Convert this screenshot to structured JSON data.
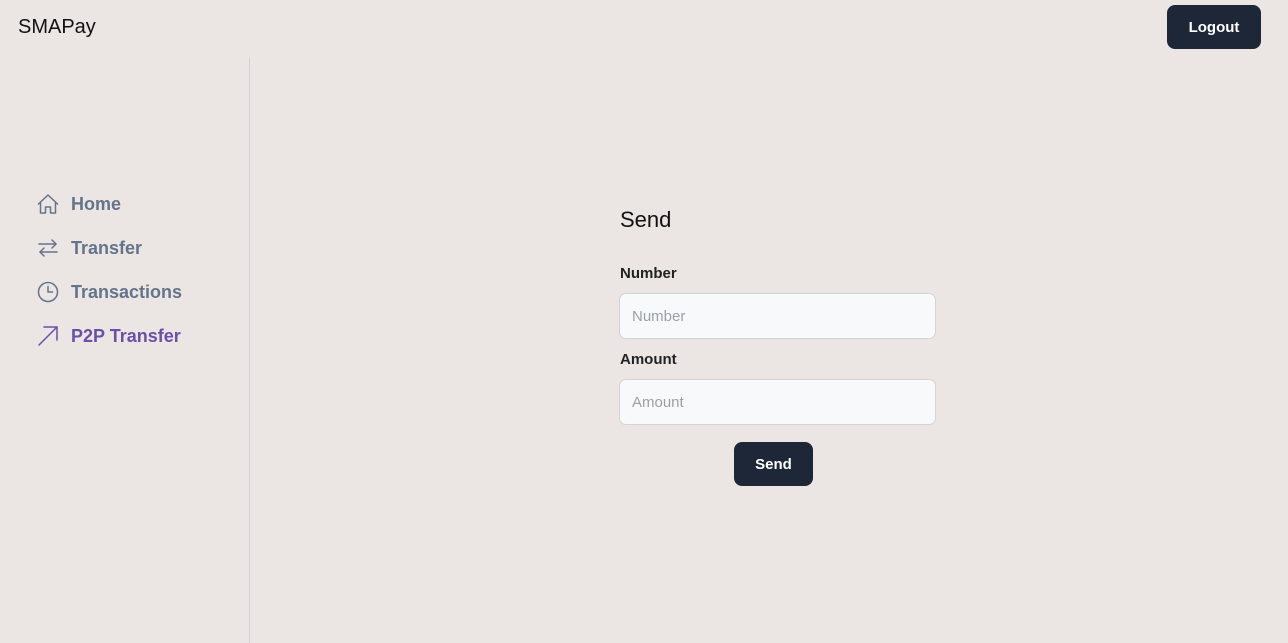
{
  "header": {
    "brand": "SMAPay",
    "logout_label": "Logout"
  },
  "sidebar": {
    "items": [
      {
        "label": "Home",
        "icon": "home-icon",
        "active": false
      },
      {
        "label": "Transfer",
        "icon": "arrows-transfer-icon",
        "active": false
      },
      {
        "label": "Transactions",
        "icon": "clock-icon",
        "active": false
      },
      {
        "label": "P2P Transfer",
        "icon": "arrow-up-right-icon",
        "active": true
      }
    ]
  },
  "form": {
    "title": "Send",
    "number_label": "Number",
    "number_placeholder": "Number",
    "number_value": "",
    "amount_label": "Amount",
    "amount_placeholder": "Amount",
    "amount_value": "",
    "submit_label": "Send"
  },
  "colors": {
    "background": "#ebe6e4",
    "button": "#1e2737",
    "nav_text": "#64748b",
    "nav_active": "#6b4fa8"
  }
}
